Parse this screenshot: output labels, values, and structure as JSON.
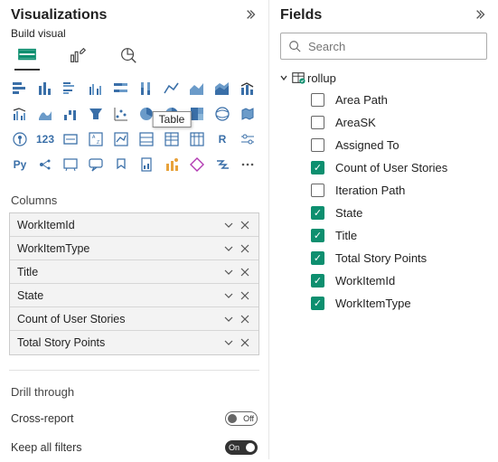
{
  "viz": {
    "title": "Visualizations",
    "build_label": "Build visual",
    "tooltip": "Table",
    "columns_label": "Columns",
    "columns": [
      "WorkItemId",
      "WorkItemType",
      "Title",
      "State",
      "Count of User Stories",
      "Total Story Points"
    ],
    "drill": {
      "title": "Drill through",
      "cross_report_label": "Cross-report",
      "cross_report_value": "Off",
      "keep_filters_label": "Keep all filters",
      "keep_filters_value": "On"
    }
  },
  "fields": {
    "title": "Fields",
    "search_placeholder": "Search",
    "table_name": "rollup",
    "items": [
      {
        "label": "Area Path",
        "checked": false
      },
      {
        "label": "AreaSK",
        "checked": false
      },
      {
        "label": "Assigned To",
        "checked": false
      },
      {
        "label": "Count of User Stories",
        "checked": true
      },
      {
        "label": "Iteration Path",
        "checked": false
      },
      {
        "label": "State",
        "checked": true
      },
      {
        "label": "Title",
        "checked": true
      },
      {
        "label": "Total Story Points",
        "checked": true
      },
      {
        "label": "WorkItemId",
        "checked": true
      },
      {
        "label": "WorkItemType",
        "checked": true
      }
    ]
  }
}
